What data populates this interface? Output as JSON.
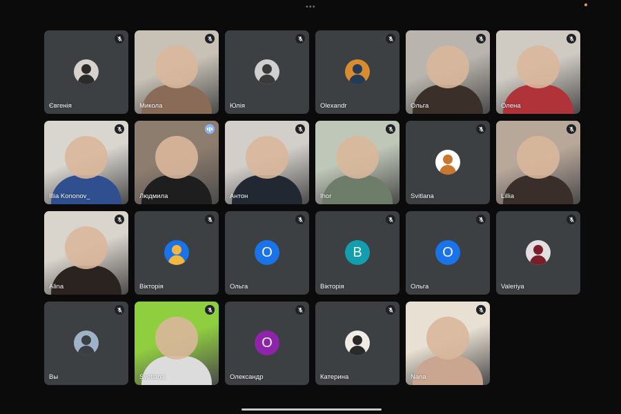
{
  "participants": [
    {
      "name": "Євгенія",
      "kind": "photo",
      "bg": "#d7d2cb",
      "fg": "#2b2b2b",
      "icon": "person-photo"
    },
    {
      "name": "Микола",
      "kind": "video",
      "bg": "#c8c2b6",
      "fg": "#8a6b57",
      "icon": "video-feed"
    },
    {
      "name": "Юлія",
      "kind": "photo",
      "bg": "#cfcfcf",
      "fg": "#3a3a3a",
      "icon": "person-photo"
    },
    {
      "name": "Olexandr",
      "kind": "photo",
      "bg": "#d88b2f",
      "fg": "#243a55",
      "icon": "person-photo"
    },
    {
      "name": "Ольга",
      "kind": "video",
      "bg": "#b9b4ad",
      "fg": "#3b2f2a",
      "icon": "video-feed"
    },
    {
      "name": "Олена",
      "kind": "video",
      "bg": "#cfcbc3",
      "fg": "#b0333a",
      "icon": "video-feed"
    },
    {
      "name": "Illia Kononov_",
      "kind": "video",
      "bg": "#d9d6d0",
      "fg": "#2f4f8f",
      "icon": "video-feed"
    },
    {
      "name": "Людмила",
      "kind": "video",
      "bg": "#8d7d6e",
      "fg": "#1e1e1e",
      "icon": "video-feed",
      "speaking": true
    },
    {
      "name": "Антон",
      "kind": "video",
      "bg": "#d2cfca",
      "fg": "#222831",
      "icon": "video-feed"
    },
    {
      "name": "Ihor",
      "kind": "video",
      "bg": "#bfc7b8",
      "fg": "#6e7d69",
      "icon": "video-feed"
    },
    {
      "name": "Svitlana",
      "kind": "photo",
      "bg": "#ffffff",
      "fg": "#c9772e",
      "icon": "person-photo"
    },
    {
      "name": "Lillia",
      "kind": "video",
      "bg": "#b8a89a",
      "fg": "#3a2e2a",
      "icon": "video-feed"
    },
    {
      "name": "Alina",
      "kind": "video",
      "bg": "#d9d4cc",
      "fg": "#2b2320",
      "icon": "video-feed"
    },
    {
      "name": "Вікторія",
      "kind": "photo",
      "bg": "#1b73e8",
      "fg": "#f3b640",
      "icon": "person-photo"
    },
    {
      "name": "Ольга",
      "kind": "letter",
      "letter": "О",
      "bg": "#1a73e8"
    },
    {
      "name": "Вікторія",
      "kind": "letter",
      "letter": "В",
      "bg": "#129eaf"
    },
    {
      "name": "Ольга",
      "kind": "letter",
      "letter": "О",
      "bg": "#1a73e8"
    },
    {
      "name": "Valeriya",
      "kind": "photo",
      "bg": "#e3dfe0",
      "fg": "#7a1f2a",
      "icon": "person-photo"
    },
    {
      "name": "Вы",
      "kind": "photo",
      "bg": "#9fb3c8",
      "fg": "#3a3f44",
      "icon": "person-photo"
    },
    {
      "name": "Svetlana",
      "kind": "video",
      "bg": "#8fce3f",
      "fg": "#dcdcdc",
      "icon": "video-feed"
    },
    {
      "name": "Олександр",
      "kind": "letter",
      "letter": "О",
      "bg": "#8e24aa"
    },
    {
      "name": "Катерина",
      "kind": "photo",
      "bg": "#f1ebe6",
      "fg": "#2a2a2a",
      "icon": "person-photo"
    },
    {
      "name": "Nana",
      "kind": "video",
      "bg": "#e8e0d2",
      "fg": "#caa58f",
      "icon": "video-feed"
    }
  ],
  "icons": {
    "mic_off": "mic-off-icon",
    "speaking": "audio-level-icon"
  },
  "colors": {
    "tile": "#3c4043",
    "background": "#0b0b0c",
    "recording_dot": "#f29b38"
  }
}
